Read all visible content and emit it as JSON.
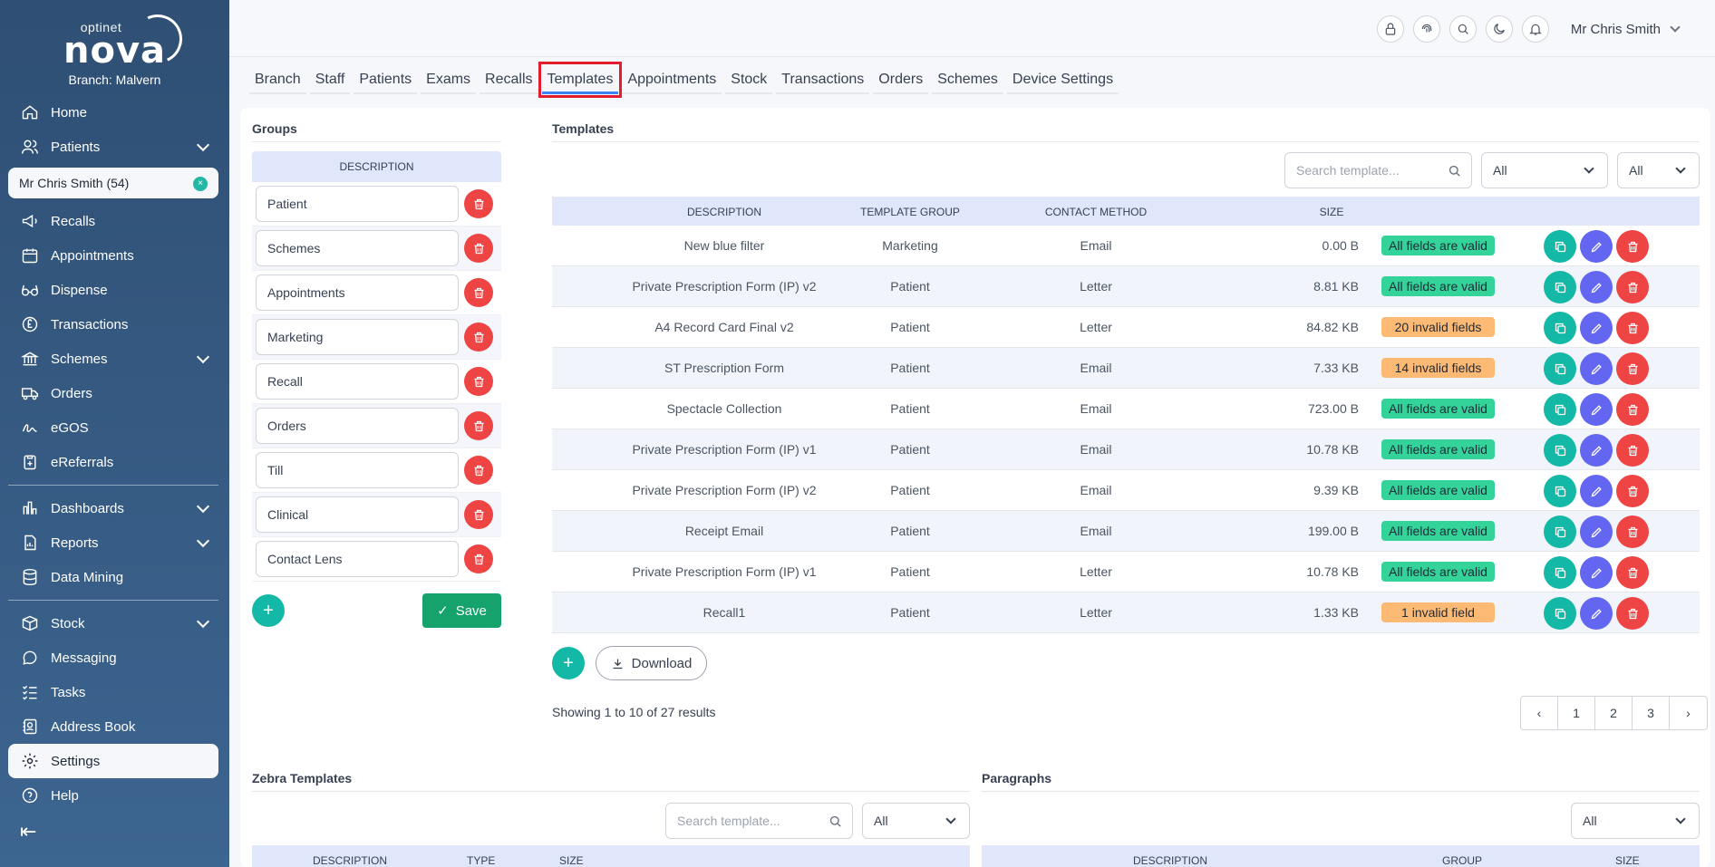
{
  "brand": {
    "small": "optinet",
    "name": "nova",
    "branch": "Branch: Malvern"
  },
  "sidebar": {
    "patient_pill": "Mr Chris Smith (54)",
    "items": [
      {
        "label": "Home"
      },
      {
        "label": "Patients"
      },
      {
        "label": "Recalls"
      },
      {
        "label": "Appointments"
      },
      {
        "label": "Dispense"
      },
      {
        "label": "Transactions"
      },
      {
        "label": "Schemes"
      },
      {
        "label": "Orders"
      },
      {
        "label": "eGOS"
      },
      {
        "label": "eReferrals"
      },
      {
        "label": "Dashboards"
      },
      {
        "label": "Reports"
      },
      {
        "label": "Data Mining"
      },
      {
        "label": "Stock"
      },
      {
        "label": "Messaging"
      },
      {
        "label": "Tasks"
      },
      {
        "label": "Address Book"
      },
      {
        "label": "Settings"
      },
      {
        "label": "Help"
      }
    ]
  },
  "header": {
    "user": "Mr Chris Smith"
  },
  "tabs": [
    "Branch",
    "Staff",
    "Patients",
    "Exams",
    "Recalls",
    "Templates",
    "Appointments",
    "Stock",
    "Transactions",
    "Orders",
    "Schemes",
    "Device Settings"
  ],
  "groups": {
    "title": "Groups",
    "column": "DESCRIPTION",
    "items": [
      "Patient",
      "Schemes",
      "Appointments",
      "Marketing",
      "Recall",
      "Orders",
      "Till",
      "Clinical",
      "Contact Lens"
    ],
    "save_label": "Save",
    "add_label": "+"
  },
  "templates": {
    "title": "Templates",
    "search_placeholder": "Search template...",
    "filter1": "All",
    "filter2": "All",
    "columns": [
      "DESCRIPTION",
      "TEMPLATE GROUP",
      "CONTACT METHOD",
      "SIZE"
    ],
    "rows": [
      {
        "description": "New blue filter",
        "group": "Marketing",
        "method": "Email",
        "size": "0.00 B",
        "status": "All fields are valid"
      },
      {
        "description": "Private Prescription Form (IP) v2",
        "group": "Patient",
        "method": "Letter",
        "size": "8.81 KB",
        "status": "All fields are valid"
      },
      {
        "description": "A4 Record Card Final v2",
        "group": "Patient",
        "method": "Letter",
        "size": "84.82 KB",
        "status": "20 invalid fields"
      },
      {
        "description": "ST Prescription Form",
        "group": "Patient",
        "method": "Email",
        "size": "7.33 KB",
        "status": "14 invalid fields"
      },
      {
        "description": "Spectacle Collection",
        "group": "Patient",
        "method": "Email",
        "size": "723.00 B",
        "status": "All fields are valid"
      },
      {
        "description": "Private Prescription Form (IP) v1",
        "group": "Patient",
        "method": "Email",
        "size": "10.78 KB",
        "status": "All fields are valid"
      },
      {
        "description": "Private Prescription Form (IP) v2",
        "group": "Patient",
        "method": "Email",
        "size": "9.39 KB",
        "status": "All fields are valid"
      },
      {
        "description": "Receipt Email",
        "group": "Patient",
        "method": "Email",
        "size": "199.00 B",
        "status": "All fields are valid"
      },
      {
        "description": "Private Prescription Form (IP) v1",
        "group": "Patient",
        "method": "Letter",
        "size": "10.78 KB",
        "status": "All fields are valid"
      },
      {
        "description": "Recall1",
        "group": "Patient",
        "method": "Letter",
        "size": "1.33 KB",
        "status": "1 invalid field"
      }
    ],
    "download_label": "Download",
    "showing": "Showing 1 to 10 of 27 results",
    "pages": [
      "1",
      "2",
      "3"
    ]
  },
  "zebra": {
    "title": "Zebra Templates",
    "search_placeholder": "Search template...",
    "filter": "All",
    "columns": [
      "DESCRIPTION",
      "TYPE",
      "SIZE"
    ]
  },
  "paragraphs": {
    "title": "Paragraphs",
    "filter": "All",
    "columns": [
      "DESCRIPTION",
      "GROUP",
      "SIZE"
    ]
  },
  "colors": {
    "sidebar": "#2f4f74",
    "accent": "#14b8a6",
    "danger": "#ef4444",
    "edit": "#6366f1",
    "save": "#16a36b",
    "valid": "#34d399",
    "invalid": "#fdba74",
    "tab_highlight": "#e11d2e"
  }
}
